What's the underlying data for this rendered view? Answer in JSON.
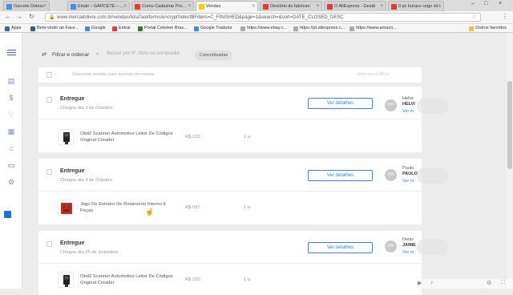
{
  "browser": {
    "tabs": [
      {
        "title": "Garcete Delesc",
        "color": "#4a90d9"
      },
      {
        "title": "Email – GARCETE – ...",
        "color": "#4a90d9"
      },
      {
        "title": "Como Cadastrar Pro...",
        "color": "#e53935"
      },
      {
        "title": "Vendas",
        "color": "#f6d000"
      },
      {
        "title": "Diretório do fabrican",
        "color": "#e53935"
      },
      {
        "title": "O AliExpress - Gestã",
        "color": "#e53935"
      },
      {
        "title": "9 pc buraco cego sli...",
        "color": "#e53935"
      }
    ],
    "url": "www.mercadolivre.com.br/vendas/listaTaskforms/encryptSelectBFilters=C_FINISHED&page=1&search=&sort=DATE_CLOSED_DESC",
    "bookmarks": [
      "Apps",
      "Bem-vindo ao Face...",
      "Google",
      "Entrar",
      "Portal Cetelem Bras...",
      "Google Tradutor",
      "https://www.ebay.c...",
      "https://pt.aliexpress.c...",
      "https://www.amazo..."
    ],
    "bookmarks_other": "Outros favoritos"
  },
  "filter": {
    "label": "Filtrar e ordenar",
    "search_placeholder": "Buscar por nº, título ou comprador",
    "chip": "Concretizadas"
  },
  "bulk": {
    "label": "Selecione vendas para acionar em massa",
    "info": "Informar à NF-e"
  },
  "orders": [
    {
      "status": "Entregue",
      "date": "Chegou dia 3 de Outubro",
      "button": "Ver detalhes",
      "product": "Obd2 Scanner Automotivo Leitor De Códigos Original Creader",
      "price": "R$ 220",
      "qty": "1 u.",
      "initials": "HH",
      "buyer_first": "Helve",
      "buyer_last": "HELVI",
      "more": "Ver m"
    },
    {
      "status": "Entregue",
      "date": "Chegou dia 4 de Outubro",
      "button": "Ver detalhes",
      "product": "Jogo De Extrator De Rolamento Interno 9 Peças",
      "price": "R$ 097",
      "qty": "1 u.",
      "initials": "PH",
      "buyer_first": "Paulo",
      "buyer_last": "PAULO",
      "more": "Ver m"
    },
    {
      "status": "Entregue",
      "date": "Chegou dia 25 de Setembro",
      "button": "Ver detalhes",
      "product": "Obd2 Scanner Automotivo Leitor De Códigos Original Creader",
      "price": "R$ 220",
      "qty": "1 u.",
      "initials": "DS",
      "buyer_first": "Denis",
      "buyer_last": "JAIME",
      "more": "Ver m"
    }
  ]
}
